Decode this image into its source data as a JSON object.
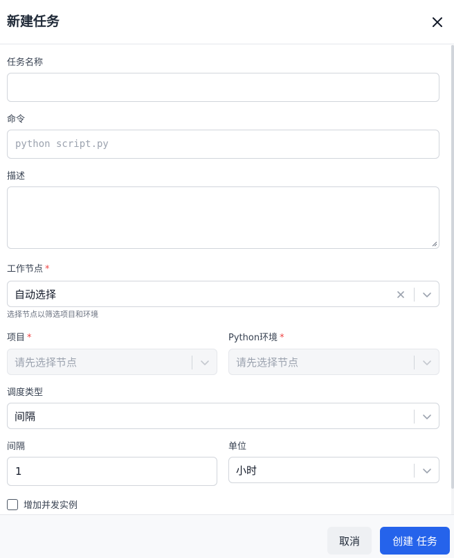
{
  "dialog": {
    "title": "新建任务"
  },
  "form": {
    "name": {
      "label": "任务名称",
      "value": ""
    },
    "command": {
      "label": "命令",
      "placeholder": "python script.py"
    },
    "description": {
      "label": "描述",
      "value": ""
    },
    "worker_node": {
      "label": "工作节点",
      "required_mark": "*",
      "value": "自动选择",
      "hint": "选择节点以筛选项目和环境"
    },
    "project": {
      "label": "项目",
      "required_mark": "*",
      "placeholder": "请先选择节点"
    },
    "python_env": {
      "label": "Python环境",
      "required_mark": "*",
      "placeholder": "请先选择节点"
    },
    "schedule_type": {
      "label": "调度类型",
      "value": "间隔"
    },
    "interval": {
      "label": "间隔",
      "value": "1"
    },
    "unit": {
      "label": "单位",
      "value": "小时"
    },
    "concurrent": {
      "label": "增加并发实例",
      "checked": false
    }
  },
  "footer": {
    "cancel_label": "取消",
    "create_label": "创建 任务"
  },
  "colors": {
    "primary": "#2563eb",
    "required": "#ef4444"
  }
}
